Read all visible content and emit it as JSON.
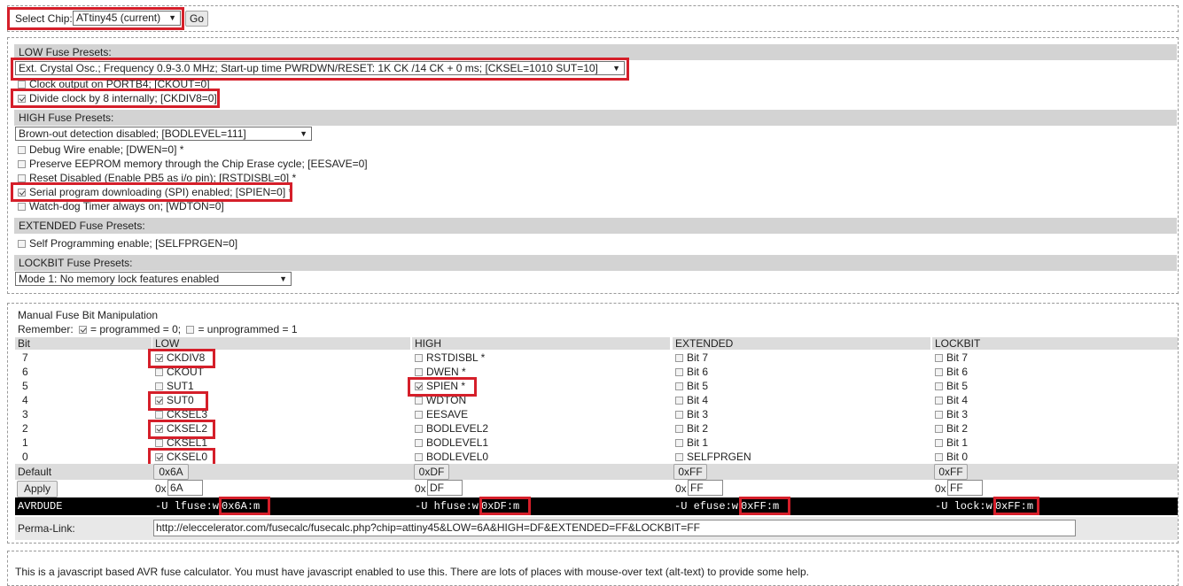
{
  "chip_select": {
    "label": "Select Chip:",
    "value": "ATtiny45 (current)",
    "go": "Go"
  },
  "presets": {
    "low": {
      "title": "LOW Fuse Presets:",
      "select": "Ext. Crystal Osc.; Frequency 0.9-3.0 MHz; Start-up time PWRDWN/RESET: 1K CK /14 CK + 0 ms; [CKSEL=1010 SUT=10]",
      "options": [
        {
          "label": "Clock output on PORTB4; [CKOUT=0]",
          "checked": false
        },
        {
          "label": "Divide clock by 8 internally; [CKDIV8=0]",
          "checked": true
        }
      ]
    },
    "high": {
      "title": "HIGH Fuse Presets:",
      "select": "Brown-out detection disabled; [BODLEVEL=111]",
      "options": [
        {
          "label": "Debug Wire enable; [DWEN=0] *",
          "checked": false
        },
        {
          "label": "Preserve EEPROM memory through the Chip Erase cycle; [EESAVE=0]",
          "checked": false
        },
        {
          "label": "Reset Disabled (Enable PB5 as i/o pin); [RSTDISBL=0] *",
          "checked": false
        },
        {
          "label": "Serial program downloading (SPI) enabled; [SPIEN=0] *",
          "checked": true
        },
        {
          "label": "Watch-dog Timer always on; [WDTON=0]",
          "checked": false
        }
      ]
    },
    "extended": {
      "title": "EXTENDED Fuse Presets:",
      "options": [
        {
          "label": "Self Programming enable; [SELFPRGEN=0]",
          "checked": false
        }
      ]
    },
    "lockbit": {
      "title": "LOCKBIT Fuse Presets:",
      "select": "Mode 1: No memory lock features enabled"
    }
  },
  "manual": {
    "title": "Manual Fuse Bit Manipulation",
    "remember_prefix": "Remember:",
    "remember_programmed": "= programmed = 0;",
    "remember_unprogrammed": "= unprogrammed = 1",
    "col_headers": [
      "Bit",
      "LOW",
      "HIGH",
      "EXTENDED",
      "LOCKBIT"
    ],
    "bits": [
      "7",
      "6",
      "5",
      "4",
      "3",
      "2",
      "1",
      "0"
    ],
    "low_bits": [
      {
        "name": "CKDIV8",
        "checked": true
      },
      {
        "name": "CKOUT",
        "checked": false
      },
      {
        "name": "SUT1",
        "checked": false
      },
      {
        "name": "SUT0",
        "checked": true
      },
      {
        "name": "CKSEL3",
        "checked": false
      },
      {
        "name": "CKSEL2",
        "checked": true
      },
      {
        "name": "CKSEL1",
        "checked": false
      },
      {
        "name": "CKSEL0",
        "checked": true
      }
    ],
    "high_bits": [
      {
        "name": "RSTDISBL *",
        "checked": false
      },
      {
        "name": "DWEN *",
        "checked": false
      },
      {
        "name": "SPIEN *",
        "checked": true
      },
      {
        "name": "WDTON",
        "checked": false
      },
      {
        "name": "EESAVE",
        "checked": false
      },
      {
        "name": "BODLEVEL2",
        "checked": false
      },
      {
        "name": "BODLEVEL1",
        "checked": false
      },
      {
        "name": "BODLEVEL0",
        "checked": false
      }
    ],
    "ext_bits": [
      {
        "name": "Bit 7",
        "checked": false
      },
      {
        "name": "Bit 6",
        "checked": false
      },
      {
        "name": "Bit 5",
        "checked": false
      },
      {
        "name": "Bit 4",
        "checked": false
      },
      {
        "name": "Bit 3",
        "checked": false
      },
      {
        "name": "Bit 2",
        "checked": false
      },
      {
        "name": "Bit 1",
        "checked": false
      },
      {
        "name": "SELFPRGEN",
        "checked": false
      }
    ],
    "lock_bits": [
      {
        "name": "Bit 7",
        "checked": false
      },
      {
        "name": "Bit 6",
        "checked": false
      },
      {
        "name": "Bit 5",
        "checked": false
      },
      {
        "name": "Bit 4",
        "checked": false
      },
      {
        "name": "Bit 3",
        "checked": false
      },
      {
        "name": "Bit 2",
        "checked": false
      },
      {
        "name": "Bit 1",
        "checked": false
      },
      {
        "name": "Bit 0",
        "checked": false
      }
    ],
    "default_label": "Default",
    "defaults": [
      "0x6A",
      "0xDF",
      "0xFF",
      "0xFF"
    ],
    "apply_label": "Apply",
    "hex_prefix": "0x",
    "hex_values": [
      "6A",
      "DF",
      "FF",
      "FF"
    ],
    "avrdude_label": "AVRDUDE",
    "avrdude": [
      {
        "cmd": "-U lfuse:w",
        "val": "0x6A:m"
      },
      {
        "cmd": "-U hfuse:w",
        "val": "0xDF:m"
      },
      {
        "cmd": "-U efuse:w",
        "val": "0xFF:m"
      },
      {
        "cmd": "-U lock:w",
        "val": "0xFF:m"
      }
    ],
    "permalink_label": "Perma-Link:",
    "permalink": "http://eleccelerator.com/fusecalc/fusecalc.php?chip=attiny45&LOW=6A&HIGH=DF&EXTENDED=FF&LOCKBIT=FF"
  },
  "footer": {
    "text": "This is a javascript based AVR fuse calculator. You must have javascript enabled to use this. There are lots of places with mouse-over text (alt-text) to provide some help."
  },
  "colors": {
    "highlight": "#d51f2a",
    "section_bar": "#d3d3d3",
    "avrdude_bar": "#000000"
  }
}
